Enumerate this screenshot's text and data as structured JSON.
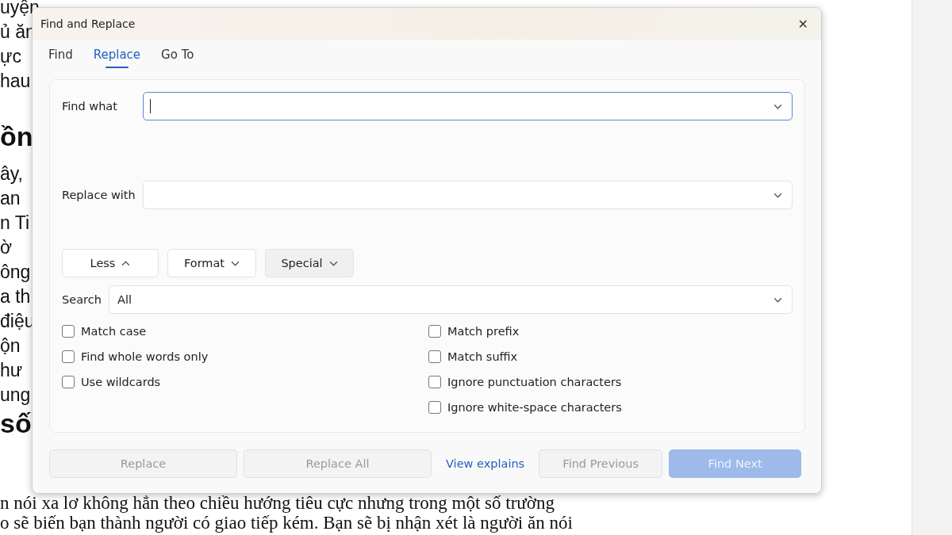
{
  "document": {
    "left_lines": [
      {
        "kind": "text",
        "text": "uyện"
      },
      {
        "kind": "text",
        "text": "ủ ăn"
      },
      {
        "kind": "text",
        "text": "ực"
      },
      {
        "kind": "text",
        "text": "hau"
      },
      {
        "kind": "heading",
        "text": "ồn"
      },
      {
        "kind": "text",
        "text": "ây,"
      },
      {
        "kind": "text",
        "text": "an"
      },
      {
        "kind": "text",
        "text": "n Ti"
      },
      {
        "kind": "text",
        "text": "ờ"
      },
      {
        "kind": "text",
        "text": "ông"
      },
      {
        "kind": "text",
        "text": "a th"
      },
      {
        "kind": "text",
        "text": "điệu"
      },
      {
        "kind": "text",
        "text": "ộn"
      },
      {
        "kind": "text",
        "text": "hư"
      },
      {
        "kind": "text",
        "text": "ung"
      },
      {
        "kind": "heading",
        "text": "số"
      }
    ],
    "bottom_lines": [
      "n nói xa lơ không hẳn theo chiều hướng tiêu cực nhưng trong một số trường",
      "o sẽ biến bạn thành người có giao tiếp kém. Bạn sẽ bị nhận xét là người ăn nói"
    ]
  },
  "dialog": {
    "title": "Find and Replace",
    "close": "✕",
    "tabs": [
      {
        "label": "Find",
        "selected": false
      },
      {
        "label": "Replace",
        "selected": true
      },
      {
        "label": "Go To",
        "selected": false
      }
    ],
    "find_what": {
      "label": "Find what",
      "focused": true
    },
    "replace_with": {
      "label": "Replace with",
      "focused": false
    },
    "option_buttons": [
      {
        "label": "Less",
        "expanded": true,
        "hovered": false
      },
      {
        "label": "Format",
        "expanded": false,
        "hovered": false
      },
      {
        "label": "Special",
        "expanded": false,
        "hovered": true
      }
    ],
    "search": {
      "label": "Search",
      "value": "All"
    },
    "left_options": [
      {
        "label": "Match case",
        "checked": false
      },
      {
        "label": "Find whole words only",
        "checked": false
      },
      {
        "label": "Use wildcards",
        "checked": false
      }
    ],
    "right_options": [
      {
        "label": "Match prefix",
        "checked": false
      },
      {
        "label": "Match suffix",
        "checked": false
      },
      {
        "label": "Ignore punctuation characters",
        "checked": false
      },
      {
        "label": "Ignore white-space characters",
        "checked": false
      }
    ],
    "actions": [
      {
        "kind": "button",
        "label": "Replace",
        "disabled": true
      },
      {
        "kind": "button",
        "label": "Replace All",
        "disabled": true
      },
      {
        "kind": "link",
        "label": "View explains"
      },
      {
        "kind": "button",
        "label": "Find Previous",
        "disabled": true
      },
      {
        "kind": "primary",
        "label": "Find Next",
        "disabled": true
      }
    ]
  }
}
